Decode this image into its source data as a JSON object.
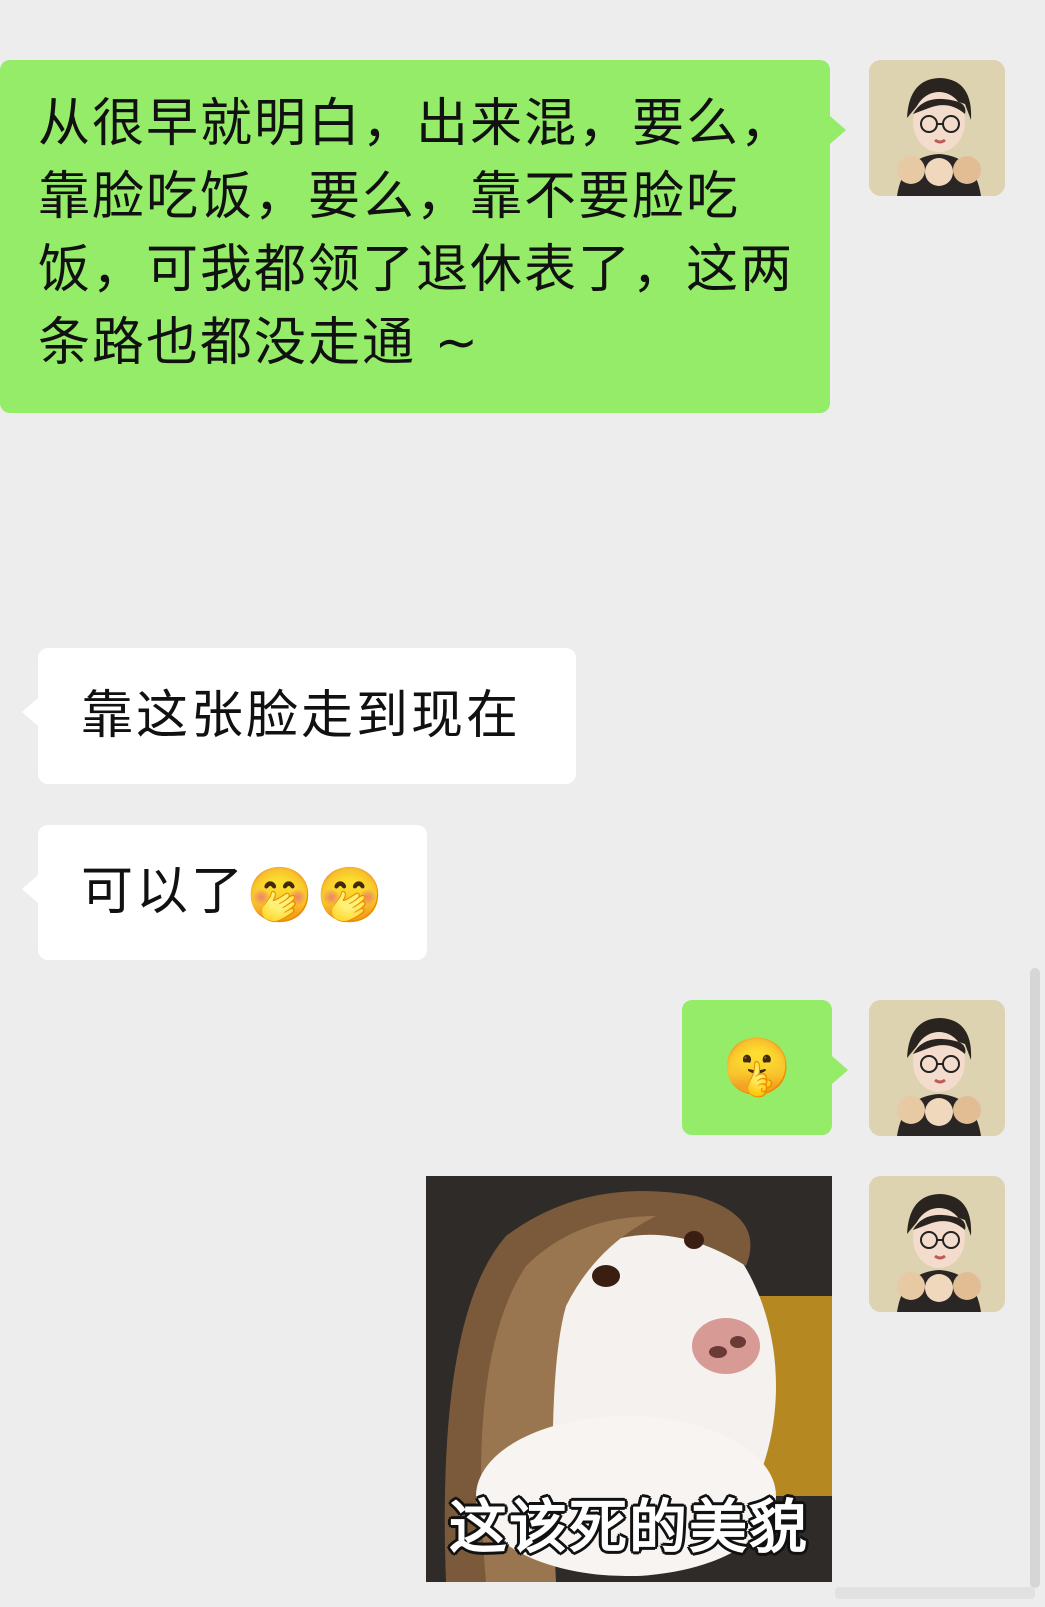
{
  "messages": [
    {
      "from": "me",
      "text": "从很早就明白，出来混，要么，靠脸吃饭，要么，靠不要脸吃饭，可我都领了退休表了，这两条路也都没走通 ~"
    },
    {
      "from": "other",
      "text": "靠这张脸走到现在"
    },
    {
      "from": "other",
      "text": "可以了",
      "emojis": "🤭🤭"
    },
    {
      "from": "me",
      "emoji": "🤫"
    },
    {
      "from": "me",
      "sticker_caption": "这该死的美貌"
    }
  ],
  "colors": {
    "sent_bubble": "#95ec69",
    "received_bubble": "#ffffff",
    "background": "#ededed"
  },
  "icons": [
    "avatar-cartoon-girl-with-cats",
    "dog-with-wig-sticker"
  ]
}
